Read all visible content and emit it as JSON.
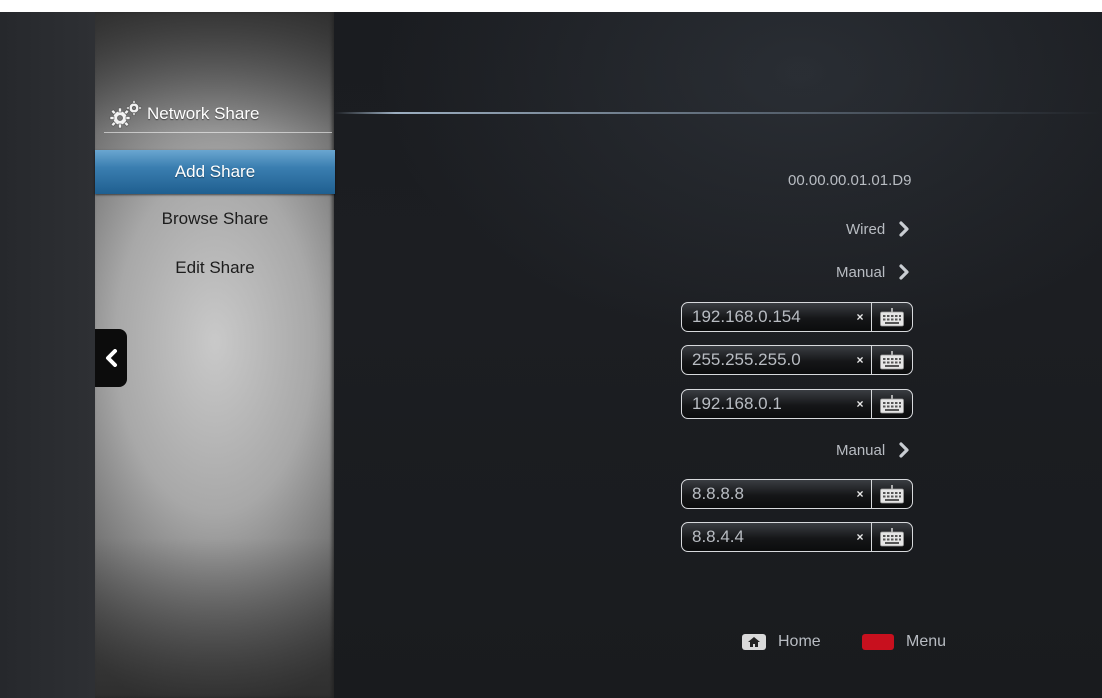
{
  "sidebar": {
    "title": "Network Share",
    "items": [
      {
        "label": "Add Share",
        "active": true
      },
      {
        "label": "Browse Share",
        "active": false
      },
      {
        "label": "Edit Share",
        "active": false
      }
    ]
  },
  "network": {
    "mac_address": "00.00.00.01.01.D9",
    "connection_type": "Wired",
    "ip_mode": "Manual",
    "ip_address": "192.168.0.154",
    "subnet_mask": "255.255.255.0",
    "gateway": "192.168.0.1",
    "dns_mode": "Manual",
    "dns_primary": "8.8.8.8",
    "dns_secondary": "8.8.4.4",
    "clear_symbol": "×"
  },
  "footer": {
    "home_label": "Home",
    "menu_label": "Menu"
  },
  "colors": {
    "active_item": "#3a7eb0",
    "menu_key": "#c8101e"
  }
}
